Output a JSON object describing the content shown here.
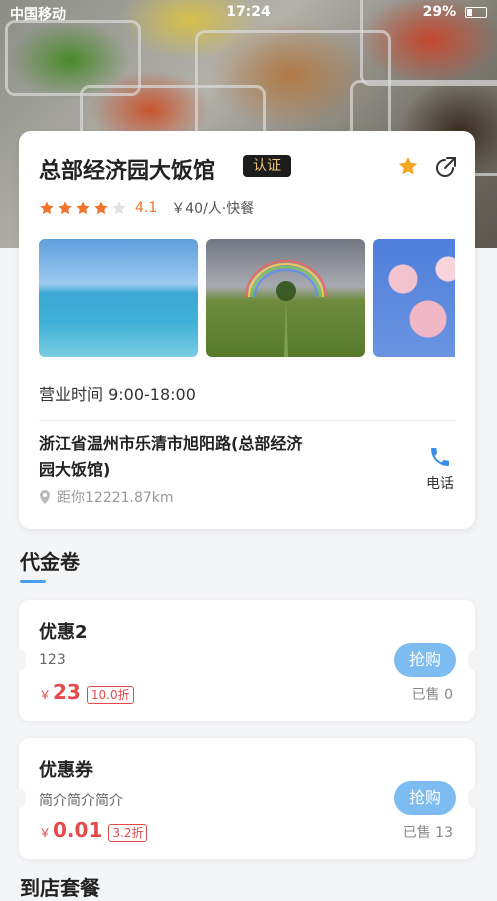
{
  "status_bar": {
    "carrier": "中国移动",
    "time": "17:24",
    "battery": "29%"
  },
  "store": {
    "name": "总部经济园大饭馆",
    "badge": "认证",
    "rating": "4.1",
    "rating_stars_filled": 4,
    "rating_stars_total": 5,
    "price": "￥40/人·快餐",
    "hours": "营业时间 9:00-18:00",
    "address": "浙江省温州市乐清市旭阳路(总部经济园大饭馆)",
    "distance": "距你12221.87km",
    "phone_label": "电话",
    "icons": {
      "favorite": "star-icon",
      "share": "share-icon",
      "location": "location-pin-icon",
      "phone": "phone-icon"
    }
  },
  "vouchers_section": {
    "title": "代金卷",
    "items": [
      {
        "title": "优惠2",
        "desc": "123",
        "currency": "￥",
        "price": "23",
        "discount": "10.0折",
        "button": "抢购",
        "sold": "已售 0"
      },
      {
        "title": "优惠券",
        "desc": "简介简介简介",
        "currency": "￥",
        "price": "0.01",
        "discount": "3.2折",
        "button": "抢购",
        "sold": "已售 13"
      }
    ]
  },
  "next_section_title": "到店套餐",
  "colors": {
    "accent": "#f0742b",
    "price_red": "#e44a4a",
    "button_blue": "#7dbcf0",
    "underline_blue": "#4a9ff0"
  }
}
